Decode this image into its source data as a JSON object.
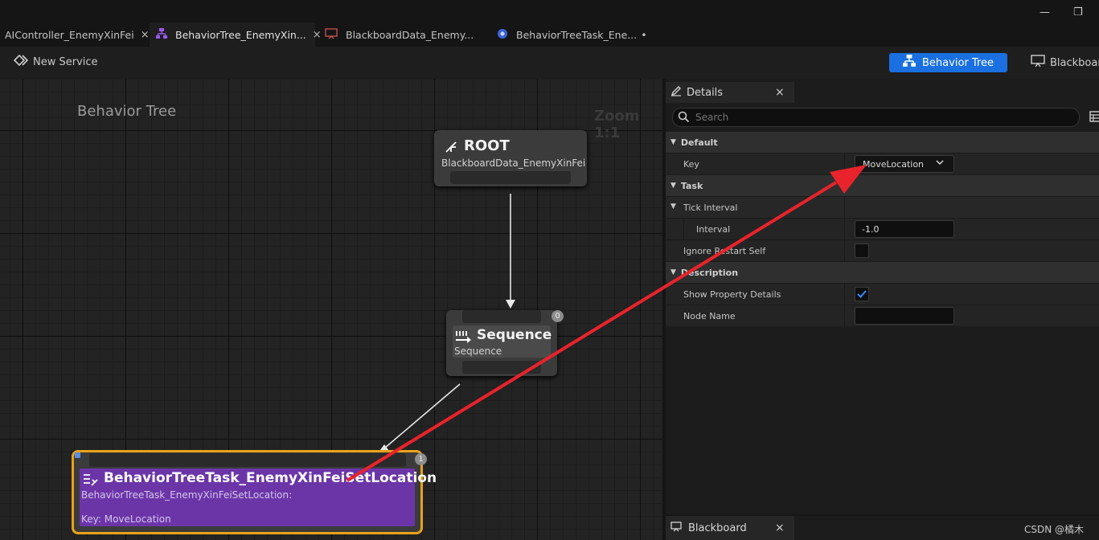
{
  "tabs": [
    {
      "label": "AIController_EnemyXinFei",
      "close": "×"
    },
    {
      "label": "BehaviorTree_EnemyXin...",
      "close": "×"
    },
    {
      "label": "BlackboardData_Enemy..."
    },
    {
      "label": "BehaviorTreeTask_Ene...",
      "modified": "•"
    }
  ],
  "window_controls": {
    "minimize": "—",
    "restore": "❐"
  },
  "toolbar": {
    "new_service": "New Service",
    "behavior_tree": "Behavior Tree",
    "blackboard": "Blackboard"
  },
  "graph": {
    "title": "Behavior Tree",
    "zoom": "Zoom 1:1",
    "root": {
      "title": "ROOT",
      "subtitle": "BlackboardData_EnemyXinFei"
    },
    "sequence": {
      "title": "Sequence",
      "subtitle": "Sequence",
      "index": "0"
    },
    "task": {
      "title": "BehaviorTreeTask_EnemyXinFeiSetLocation",
      "description": "BehaviorTreeTask_EnemyXinFeiSetLocation:",
      "key_line": "Key: MoveLocation",
      "index": "1"
    }
  },
  "details": {
    "tab_label": "Details",
    "close": "×",
    "search_placeholder": "Search",
    "categories": {
      "default": "Default",
      "task": "Task",
      "tick_interval": "Tick Interval",
      "description": "Description"
    },
    "fields": {
      "key_label": "Key",
      "key_value": "MoveLocation",
      "interval_label": "Interval",
      "interval_value": "-1.0",
      "ignore_restart_label": "Ignore Restart Self",
      "show_property_label": "Show Property Details",
      "show_property_checked": true,
      "node_name_label": "Node Name",
      "node_name_value": ""
    }
  },
  "blackboard_panel": {
    "tab_label": "Blackboard",
    "close": "×"
  },
  "watermark": "CSDN @橘木",
  "colors": {
    "accent_blue": "#1a70e0",
    "task_purple": "#6b35a8",
    "selection_orange": "#e8a21a",
    "annotation_red": "#e8232b"
  }
}
